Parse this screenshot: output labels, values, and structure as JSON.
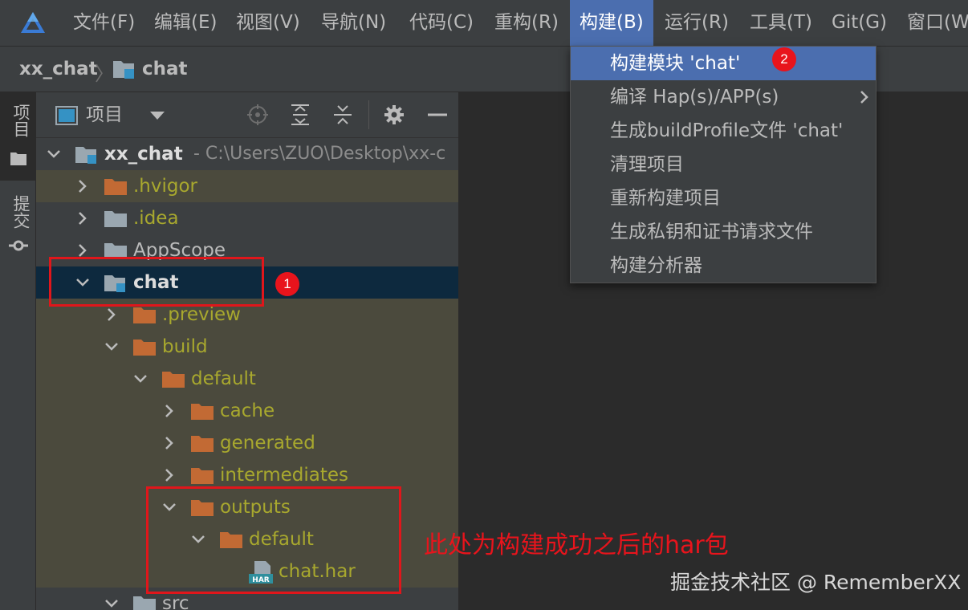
{
  "menubar": {
    "items": [
      {
        "label": "文件(F)"
      },
      {
        "label": "编辑(E)"
      },
      {
        "label": "视图(V)"
      },
      {
        "label": "导航(N)"
      },
      {
        "label": "代码(C)"
      },
      {
        "label": "重构(R)"
      },
      {
        "label": "构建(B)"
      },
      {
        "label": "运行(R)"
      },
      {
        "label": "工具(T)"
      },
      {
        "label": "Git(G)"
      },
      {
        "label": "窗口(W"
      }
    ],
    "active_item": "构建(B)"
  },
  "breadcrumb": {
    "project": "xx_chat",
    "module": "chat"
  },
  "side_stripe": {
    "tabs": [
      "项目",
      "提交"
    ]
  },
  "project_panel": {
    "title": "项目",
    "tree": [
      {
        "label": "xx_chat",
        "hint": "- C:\\Users\\ZUO\\Desktop\\xx-c",
        "type": "module",
        "expanded": true
      },
      {
        "label": ".hvigor",
        "type": "folder-excluded",
        "expanded": false
      },
      {
        "label": ".idea",
        "type": "folder",
        "expanded": false
      },
      {
        "label": "AppScope",
        "type": "folder",
        "expanded": false
      },
      {
        "label": "chat",
        "type": "module",
        "expanded": true,
        "selected": true
      },
      {
        "label": ".preview",
        "type": "folder-excluded",
        "expanded": false
      },
      {
        "label": "build",
        "type": "folder-excluded",
        "expanded": true
      },
      {
        "label": "default",
        "type": "folder-excluded",
        "expanded": true
      },
      {
        "label": "cache",
        "type": "folder-excluded",
        "expanded": false
      },
      {
        "label": "generated",
        "type": "folder-excluded",
        "expanded": false
      },
      {
        "label": "intermediates",
        "type": "folder-excluded",
        "expanded": false
      },
      {
        "label": "outputs",
        "type": "folder-excluded",
        "expanded": true
      },
      {
        "label": "default",
        "type": "folder-excluded",
        "expanded": true
      },
      {
        "label": "chat.har",
        "type": "har-file"
      },
      {
        "label": "src",
        "type": "folder",
        "expanded": true
      }
    ]
  },
  "build_menu": {
    "items": [
      {
        "label": "构建模块 'chat'",
        "highlighted": true
      },
      {
        "label": "编译 Hap(s)/APP(s)",
        "submenu": true
      },
      {
        "label": "生成buildProfile文件 'chat'"
      },
      {
        "label": "清理项目"
      },
      {
        "label": "重新构建项目"
      },
      {
        "label": "生成私钥和证书请求文件"
      },
      {
        "label": "构建分析器"
      }
    ]
  },
  "annotations": {
    "badge_1": "1",
    "badge_2": "2",
    "note": "此处为构建成功之后的har包"
  },
  "watermark": "掘金技术社区 @ RememberXX",
  "colors": {
    "menu_bg": "#3c3f41",
    "editor_bg": "#2b2b2b",
    "highlight": "#4b6eaf",
    "excluded_bg": "#4b4a3d",
    "selected_row": "#0d293e",
    "folder": "#c26a34",
    "excluded_text": "#a8a82e",
    "annotation_red": "#e0161b"
  }
}
